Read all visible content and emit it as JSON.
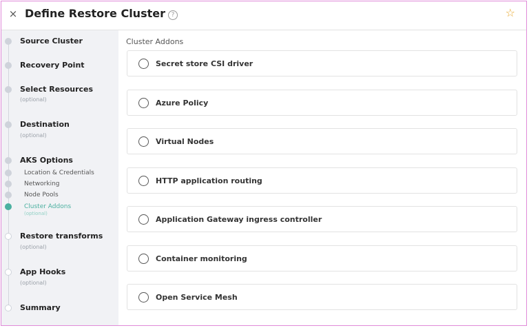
{
  "header": {
    "title": "Define Restore Cluster",
    "close_icon": "×",
    "help_icon": "?",
    "star_icon": "☆"
  },
  "sidebar": {
    "steps": [
      {
        "label": "Source Cluster"
      },
      {
        "label": "Recovery Point"
      },
      {
        "label": "Select Resources",
        "sub": "(optional)"
      },
      {
        "label": "Destination",
        "sub": "(optional)"
      },
      {
        "label": "AKS Options"
      },
      {
        "label": "Restore transforms",
        "sub": "(optional)"
      },
      {
        "label": "App Hooks",
        "sub": "(optional)"
      },
      {
        "label": "Summary"
      }
    ],
    "aks_substeps": [
      {
        "label": "Location & Credentials"
      },
      {
        "label": "Networking"
      },
      {
        "label": "Node Pools"
      },
      {
        "label": "Cluster Addons",
        "sub": "(optional)",
        "active": true
      }
    ]
  },
  "content": {
    "section_title": "Cluster Addons",
    "addons": [
      {
        "label": "Secret store CSI driver",
        "checked": false
      },
      {
        "label": "Azure Policy",
        "checked": false
      },
      {
        "label": "Virtual Nodes",
        "checked": false
      },
      {
        "label": "HTTP application routing",
        "checked": false
      },
      {
        "label": "Application Gateway ingress controller",
        "checked": false
      },
      {
        "label": "Container monitoring",
        "checked": false
      },
      {
        "label": "Open Service Mesh",
        "checked": false
      }
    ]
  },
  "colors": {
    "accent": "#4bb0a0",
    "star": "#e8a62a",
    "frame_border": "#e08ad8",
    "sidebar_bg": "#f1f2f5"
  }
}
